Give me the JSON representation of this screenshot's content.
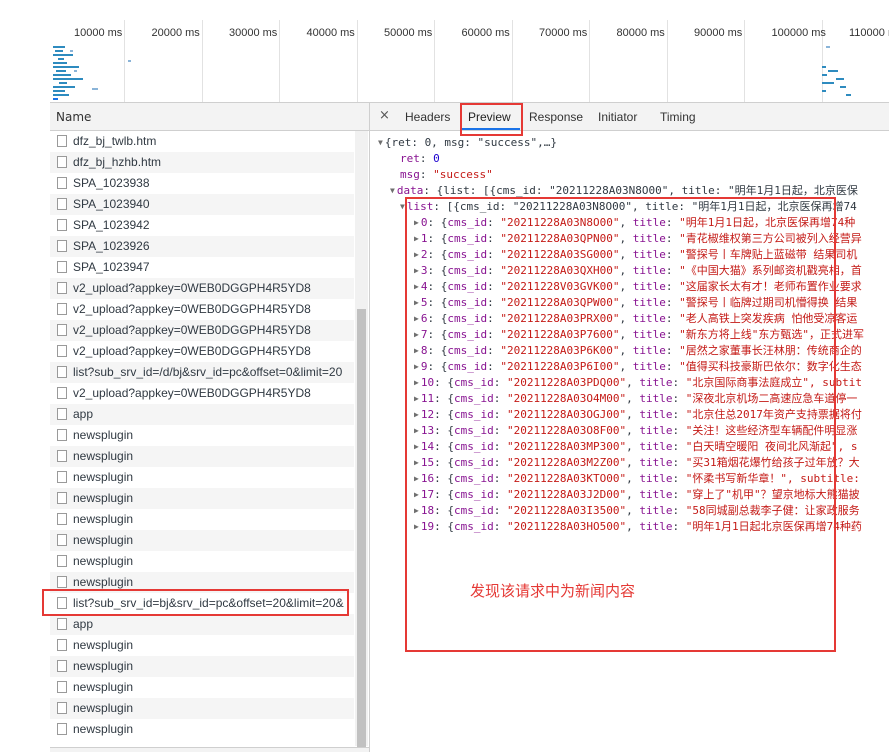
{
  "timeline": {
    "ticks": [
      "10000 ms",
      "20000 ms",
      "30000 ms",
      "40000 ms",
      "50000 ms",
      "60000 ms",
      "70000 ms",
      "80000 ms",
      "90000 ms",
      "100000 ms",
      "110000 m"
    ]
  },
  "requests": {
    "column_header": "Name",
    "rows": [
      "dfz_bj_twlb.htm",
      "dfz_bj_hzhb.htm",
      "SPA_1023938",
      "SPA_1023940",
      "SPA_1023942",
      "SPA_1023926",
      "SPA_1023947",
      "v2_upload?appkey=0WEB0DGGPH4R5YD8",
      "v2_upload?appkey=0WEB0DGGPH4R5YD8",
      "v2_upload?appkey=0WEB0DGGPH4R5YD8",
      "v2_upload?appkey=0WEB0DGGPH4R5YD8",
      "list?sub_srv_id=/d/bj&srv_id=pc&offset=0&limit=20",
      "v2_upload?appkey=0WEB0DGGPH4R5YD8",
      "app",
      "newsplugin",
      "newsplugin",
      "newsplugin",
      "newsplugin",
      "newsplugin",
      "newsplugin",
      "newsplugin",
      "newsplugin",
      "list?sub_srv_id=bj&srv_id=pc&offset=20&limit=20&",
      "app",
      "newsplugin",
      "newsplugin",
      "newsplugin",
      "newsplugin",
      "newsplugin"
    ],
    "selected_index": 22
  },
  "detail": {
    "close_symbol": "×",
    "tabs": [
      "Headers",
      "Preview",
      "Response",
      "Initiator",
      "Timing"
    ],
    "active_tab": "Preview",
    "root_line": "{ret: 0, msg: \"success\",…}",
    "ret_key": "ret",
    "ret_val": "0",
    "msg_key": "msg",
    "msg_val": "\"success\"",
    "data_key": "data",
    "data_preview": "{list: [{cms_id: \"20211228A03N8O00\", title: \"明年1月1日起，北京医保",
    "list_key": "list",
    "list_preview": "[{cms_id: \"20211228A03N8O00\", title: \"明年1月1日起，北京医保再增74",
    "items": [
      {
        "idx": "0",
        "id": "\"20211228A03N8O00\"",
        "title": "\"明年1月1日起，北京医保再增74种"
      },
      {
        "idx": "1",
        "id": "\"20211228A03QPN00\"",
        "title": "\"青花椒维权第三方公司被列入经营异"
      },
      {
        "idx": "2",
        "id": "\"20211228A03SG000\"",
        "title": "\"警探号丨车牌贴上蓝磁带 结果司机"
      },
      {
        "idx": "3",
        "id": "\"20211228A03QXH00\"",
        "title": "\"《中国大猫》系列邮资机戳亮相，首"
      },
      {
        "idx": "4",
        "id": "\"20211228V03GVK00\"",
        "title": "\"这届家长太有才！老师布置作业要求"
      },
      {
        "idx": "5",
        "id": "\"20211228A03QPW00\"",
        "title": "\"警探号丨临牌过期司机懵得换 结果"
      },
      {
        "idx": "6",
        "id": "\"20211228A03PRX00\"",
        "title": "\"老人高铁上突发疾病 怕他受凉客运"
      },
      {
        "idx": "7",
        "id": "\"20211228A03P7600\"",
        "title": "\"新东方将上线\"东方甄选\"，正式进军"
      },
      {
        "idx": "8",
        "id": "\"20211228A03P6K00\"",
        "title": "\"居然之家董事长汪林朋：传统商企的"
      },
      {
        "idx": "9",
        "id": "\"20211228A03P6I00\"",
        "title": "\"值得买科技豪斯巴依尔：数字化生态"
      },
      {
        "idx": "10",
        "id": "\"20211228A03PDQ00\"",
        "title": "\"北京国际商事法庭成立\", subtit"
      },
      {
        "idx": "11",
        "id": "\"20211228A03O4M00\"",
        "title": "\"深夜北京机场二高速应急车道停一"
      },
      {
        "idx": "12",
        "id": "\"20211228A03OGJ00\"",
        "title": "\"北京住总2017年资产支持票据将付"
      },
      {
        "idx": "13",
        "id": "\"20211228A03O8F00\"",
        "title": "\"关注！这些经济型车辆配件明显涨"
      },
      {
        "idx": "14",
        "id": "\"20211228A03MP300\"",
        "title": "\"白天晴空暖阳 夜间北风渐起\", s"
      },
      {
        "idx": "15",
        "id": "\"20211228A03M2Z00\"",
        "title": "\"买31箱烟花爆竹给孩子过年放？大"
      },
      {
        "idx": "16",
        "id": "\"20211228A03KTO00\"",
        "title": "\"怀柔书写新华章！\", subtitle:"
      },
      {
        "idx": "17",
        "id": "\"20211228A03J2D00\"",
        "title": "\"穿上了\"机甲\"？望京地标大熊猫披"
      },
      {
        "idx": "18",
        "id": "\"20211228A03I3500\"",
        "title": "\"58同城副总裁李子健：让家政服务"
      },
      {
        "idx": "19",
        "id": "\"20211228A03HO500\"",
        "title": "\"明年1月1日起北京医保再增74种药"
      }
    ],
    "cms_key": "cms_id",
    "title_key": "title"
  },
  "annotation": "发现该请求中为新闻内容",
  "colors": {
    "highlight_red": "#e53935",
    "json_key": "#881391",
    "json_string": "#c41a16",
    "json_number": "#1c00cf"
  }
}
